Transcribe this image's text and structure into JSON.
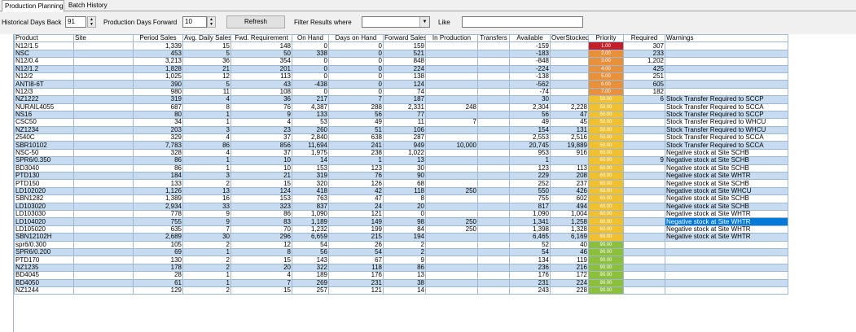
{
  "tabs": [
    "Production Planning",
    "Batch History"
  ],
  "toolbar": {
    "hist_label": "Historical Days Back",
    "hist_value": "91",
    "fwd_label": "Production Days Forward",
    "fwd_value": "10",
    "refresh_label": "Refresh",
    "filter_label": "Filter Results where",
    "filter_value": "",
    "like_label": "Like",
    "like_value": ""
  },
  "colors": {
    "red": "#c0202a",
    "orange": "#e8903a",
    "yellow": "#f0c030",
    "green": "#8cbf3c",
    "selected": "#0078d7"
  },
  "table": {
    "columns": [
      "Product",
      "Site",
      "Period Sales",
      "Avg. Daily Sales",
      "Fwd. Requirement",
      "On Hand",
      "Days on Hand",
      "Forward Sales",
      "In Production",
      "Transfers",
      "Available",
      "OverStocked",
      "Priority",
      "Required",
      "Warnings"
    ],
    "rows": [
      [
        "N12/1.5",
        "",
        "1,339",
        "15",
        "148",
        "0",
        "0",
        "159",
        "",
        "",
        "-159",
        "",
        "1.00",
        "307",
        ""
      ],
      [
        "NSC",
        "",
        "453",
        "5",
        "50",
        "338",
        "0",
        "521",
        "",
        "",
        "-183",
        "",
        "2.00",
        "233",
        ""
      ],
      [
        "N12/0.4",
        "",
        "3,213",
        "36",
        "354",
        "0",
        "0",
        "848",
        "",
        "",
        "-848",
        "",
        "3.00",
        "1,202",
        ""
      ],
      [
        "N12/1.2",
        "",
        "1,828",
        "21",
        "201",
        "0",
        "0",
        "224",
        "",
        "",
        "-224",
        "",
        "4.00",
        "425",
        ""
      ],
      [
        "N12/2",
        "",
        "1,025",
        "12",
        "113",
        "0",
        "0",
        "138",
        "",
        "",
        "-138",
        "",
        "5.00",
        "251",
        ""
      ],
      [
        "ANTI8-6T",
        "",
        "390",
        "5",
        "43",
        "-438",
        "0",
        "124",
        "",
        "",
        "-562",
        "",
        "6.00",
        "605",
        ""
      ],
      [
        "N12/3",
        "",
        "980",
        "11",
        "108",
        "0",
        "0",
        "74",
        "",
        "",
        "-74",
        "",
        "7.00",
        "182",
        ""
      ],
      [
        "NZ1222",
        "",
        "319",
        "4",
        "36",
        "217",
        "7",
        "187",
        "",
        "",
        "30",
        "",
        "50.00",
        "6",
        "Stock Transfer Required to SCCP"
      ],
      [
        "NURAIL4055",
        "",
        "687",
        "8",
        "76",
        "4,387",
        "288",
        "2,331",
        "248",
        "",
        "2,304",
        "2,228",
        "50.00",
        "",
        "Stock Transfer Required to SCCA"
      ],
      [
        "NS16",
        "",
        "80",
        "1",
        "9",
        "133",
        "56",
        "77",
        "",
        "",
        "56",
        "47",
        "50.00",
        "",
        "Stock Transfer Required to SCCP"
      ],
      [
        "CSC50",
        "",
        "34",
        "1",
        "4",
        "53",
        "49",
        "11",
        "7",
        "",
        "49",
        "45",
        "50.00",
        "",
        "Stock Transfer Required to WHCU"
      ],
      [
        "NZ1234",
        "",
        "203",
        "3",
        "23",
        "260",
        "51",
        "106",
        "",
        "",
        "154",
        "131",
        "50.00",
        "",
        "Stock Transfer Required to WHCU"
      ],
      [
        "2540C",
        "",
        "329",
        "4",
        "37",
        "2,840",
        "638",
        "287",
        "",
        "",
        "2,553",
        "2,516",
        "50.00",
        "",
        "Stock Transfer Required to SCCA"
      ],
      [
        "SBR10102",
        "",
        "7,783",
        "86",
        "856",
        "11,694",
        "241",
        "949",
        "10,000",
        "",
        "20,745",
        "19,889",
        "50.00",
        "",
        "Stock Transfer Required to SCCA"
      ],
      [
        "NSC-50",
        "",
        "328",
        "4",
        "37",
        "1,975",
        "238",
        "1,022",
        "",
        "",
        "953",
        "916",
        "60.00",
        "",
        "Negative stock at Site SCHB"
      ],
      [
        "SPR6/0.350",
        "",
        "86",
        "1",
        "10",
        "14",
        "1",
        "13",
        "",
        "",
        "1",
        "",
        "60.00",
        "9",
        "Negative stock at Site SCHB"
      ],
      [
        "BD3040",
        "",
        "86",
        "1",
        "10",
        "153",
        "123",
        "30",
        "",
        "",
        "123",
        "113",
        "60.00",
        "",
        "Negative stock at Site SCHB"
      ],
      [
        "PTD130",
        "",
        "184",
        "3",
        "21",
        "319",
        "76",
        "90",
        "",
        "",
        "229",
        "208",
        "60.00",
        "",
        "Negative stock at Site WHTR"
      ],
      [
        "PTD150",
        "",
        "133",
        "2",
        "15",
        "320",
        "126",
        "68",
        "",
        "",
        "252",
        "237",
        "60.00",
        "",
        "Negative stock at Site SCHB"
      ],
      [
        "LD102020",
        "",
        "1,126",
        "13",
        "124",
        "418",
        "42",
        "118",
        "250",
        "",
        "550",
        "426",
        "60.00",
        "",
        "Negative stock at Site WHCU"
      ],
      [
        "SBN1282",
        "",
        "1,389",
        "16",
        "153",
        "763",
        "47",
        "8",
        "",
        "",
        "755",
        "602",
        "60.00",
        "",
        "Negative stock at Site SCHB"
      ],
      [
        "LD103020",
        "",
        "2,934",
        "33",
        "323",
        "837",
        "24",
        "20",
        "",
        "",
        "817",
        "494",
        "60.00",
        "",
        "Negative stock at Site SCHB"
      ],
      [
        "LD103030",
        "",
        "778",
        "9",
        "86",
        "1,090",
        "121",
        "0",
        "",
        "",
        "1,090",
        "1,004",
        "60.00",
        "",
        "Negative stock at Site WHTR"
      ],
      [
        "LD104020",
        "",
        "755",
        "9",
        "83",
        "1,189",
        "149",
        "98",
        "250",
        "",
        "1,341",
        "1,258",
        "60.00",
        "",
        "Negative stock at Site WHTR"
      ],
      [
        "LD105020",
        "",
        "635",
        "7",
        "70",
        "1,232",
        "199",
        "84",
        "250",
        "",
        "1,398",
        "1,328",
        "60.00",
        "",
        "Negative stock at Site WHTR"
      ],
      [
        "SBN12102H",
        "",
        "2,689",
        "30",
        "296",
        "6,659",
        "215",
        "194",
        "",
        "",
        "6,465",
        "6,169",
        "60.00",
        "",
        "Negative stock at Site WHTR"
      ],
      [
        "spr6/0.300",
        "",
        "105",
        "2",
        "12",
        "54",
        "26",
        "2",
        "",
        "",
        "52",
        "40",
        "90.00",
        "",
        ""
      ],
      [
        "SPR6/0.200",
        "",
        "69",
        "1",
        "8",
        "56",
        "54",
        "2",
        "",
        "",
        "54",
        "46",
        "90.00",
        "",
        ""
      ],
      [
        "PTD170",
        "",
        "130",
        "2",
        "15",
        "143",
        "67",
        "9",
        "",
        "",
        "134",
        "119",
        "90.00",
        "",
        ""
      ],
      [
        "NZ1235",
        "",
        "178",
        "2",
        "20",
        "322",
        "118",
        "86",
        "",
        "",
        "236",
        "216",
        "90.00",
        "",
        ""
      ],
      [
        "BD4045",
        "",
        "28",
        "1",
        "4",
        "189",
        "176",
        "13",
        "",
        "",
        "176",
        "172",
        "90.00",
        "",
        ""
      ],
      [
        "BD4050",
        "",
        "61",
        "1",
        "7",
        "269",
        "231",
        "38",
        "",
        "",
        "231",
        "224",
        "90.00",
        "",
        ""
      ],
      [
        "NZ1244",
        "",
        "129",
        "2",
        "15",
        "257",
        "121",
        "14",
        "",
        "",
        "243",
        "228",
        "90.00",
        "",
        ""
      ]
    ]
  }
}
